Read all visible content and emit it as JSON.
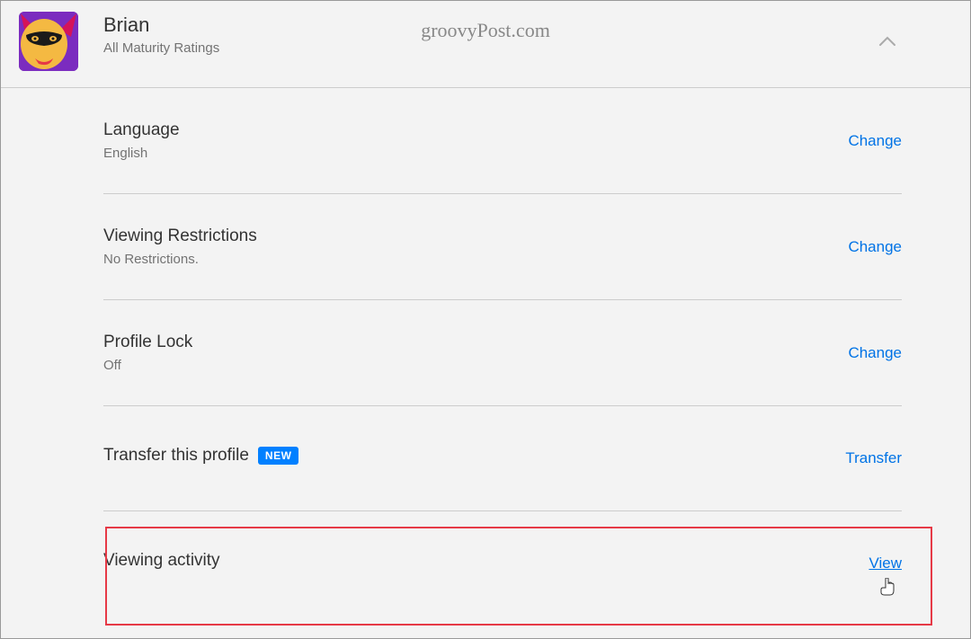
{
  "watermark": "groovyPost.com",
  "profile": {
    "name": "Brian",
    "subtitle": "All Maturity Ratings"
  },
  "settings": {
    "language": {
      "title": "Language",
      "value": "English",
      "action": "Change"
    },
    "restrictions": {
      "title": "Viewing Restrictions",
      "value": "No Restrictions.",
      "action": "Change"
    },
    "lock": {
      "title": "Profile Lock",
      "value": "Off",
      "action": "Change"
    },
    "transfer": {
      "title": "Transfer this profile",
      "badge": "NEW",
      "action": "Transfer"
    },
    "activity": {
      "title": "Viewing activity",
      "action": "View"
    }
  }
}
